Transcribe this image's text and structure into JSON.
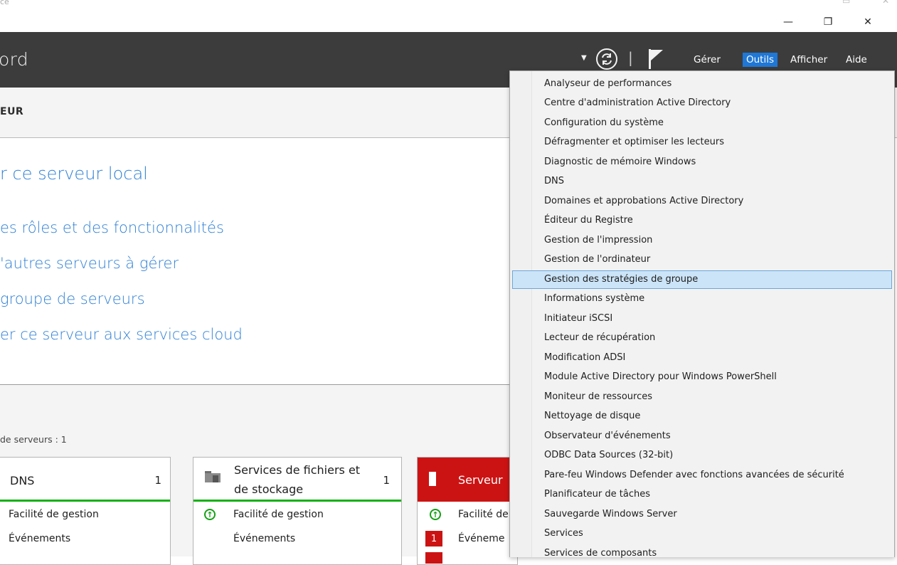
{
  "window": {
    "titlebar_fragment": "ce",
    "minimize": "—",
    "restore": "❐",
    "close": "✕"
  },
  "header": {
    "title_fragment": "ord",
    "menu": [
      "Gérer",
      "Outils",
      "Afficher",
      "Aide"
    ],
    "active_menu": "Outils"
  },
  "subheader": {
    "label_fragment": "EUR"
  },
  "welcome": {
    "links": [
      "r ce serveur local",
      "es rôles et des fonctionnalités",
      "'autres serveurs à gérer",
      "groupe de serveurs",
      "er ce serveur aux services cloud"
    ]
  },
  "server_groups": {
    "count_label": "de serveurs : 1",
    "tiles": [
      {
        "name": "DNS",
        "count": "1",
        "rows": [
          "Facilité de gestion",
          "Événements"
        ]
      },
      {
        "name": "Services de fichiers et de stockage",
        "name_line1": "Services de fichiers et",
        "name_line2": "de stockage",
        "count": "1",
        "rows": [
          "Facilité de gestion",
          "Événements"
        ]
      },
      {
        "name": "Serveur",
        "rows": [
          "Facilité de",
          "Événeme"
        ],
        "event_badge": "1"
      }
    ]
  },
  "tools_menu": {
    "items": [
      "Analyseur de performances",
      "Centre d'administration Active Directory",
      "Configuration du système",
      "Défragmenter et optimiser les lecteurs",
      "Diagnostic de mémoire Windows",
      "DNS",
      "Domaines et approbations Active Directory",
      "Éditeur du Registre",
      "Gestion de l'impression",
      "Gestion de l'ordinateur",
      "Gestion des stratégies de groupe",
      "Informations système",
      "Initiateur iSCSI",
      "Lecteur de récupération",
      "Modification ADSI",
      "Module Active Directory pour Windows PowerShell",
      "Moniteur de ressources",
      "Nettoyage de disque",
      "Observateur d'événements",
      "ODBC Data Sources (32-bit)",
      "Pare-feu Windows Defender avec fonctions avancées de sécurité",
      "Planificateur de tâches",
      "Sauvegarde Windows Server",
      "Services",
      "Services de composants"
    ],
    "highlighted": "Gestion des stratégies de groupe"
  },
  "colors": {
    "header_bg": "#3c3c3c",
    "accent": "#1f77d6",
    "link": "#2f80d5",
    "ok_green": "#15b215",
    "alert_red": "#cc1313",
    "highlight": "#cce4f7"
  }
}
